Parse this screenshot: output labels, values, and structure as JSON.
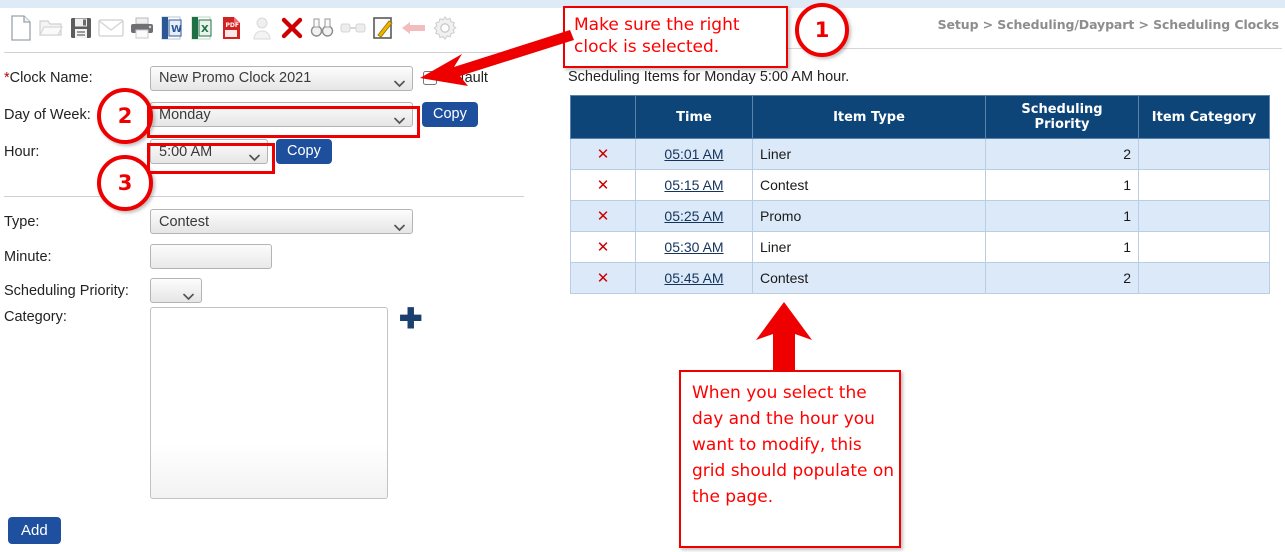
{
  "toolbar": {
    "icons": [
      {
        "name": "new-document-icon",
        "title": "New"
      },
      {
        "name": "open-folder-icon",
        "title": "Open"
      },
      {
        "name": "save-floppy-icon",
        "title": "Save"
      },
      {
        "name": "email-envelope-icon",
        "title": "Email"
      },
      {
        "name": "print-icon",
        "title": "Print"
      },
      {
        "name": "export-word-icon",
        "title": "Export to Word"
      },
      {
        "name": "export-excel-icon",
        "title": "Export to Excel"
      },
      {
        "name": "export-pdf-icon",
        "title": "Export to PDF"
      },
      {
        "name": "user-icon",
        "title": "User"
      },
      {
        "name": "delete-x-icon",
        "title": "Delete"
      },
      {
        "name": "binoculars-icon",
        "title": "Find"
      },
      {
        "name": "link-icon",
        "title": "Link"
      },
      {
        "name": "edit-note-icon",
        "title": "Edit"
      },
      {
        "name": "back-arrow-icon",
        "title": "Back"
      },
      {
        "name": "settings-gear-icon",
        "title": "Settings"
      }
    ]
  },
  "breadcrumb": {
    "text": "Setup > Scheduling/Daypart > Scheduling Clocks"
  },
  "form": {
    "clock_name": {
      "label_star": "*",
      "label": "Clock Name:",
      "value": "New Promo Clock 2021"
    },
    "default_checkbox": {
      "label": "Default",
      "checked": false
    },
    "day_of_week": {
      "label": "Day of Week:",
      "value": "Monday",
      "copy_label": "Copy"
    },
    "hour": {
      "label": "Hour:",
      "value": "5:00 AM",
      "copy_label": "Copy"
    },
    "type": {
      "label": "Type:",
      "value": "Contest"
    },
    "minute": {
      "label": "Minute:",
      "value": "",
      "placeholder": ""
    },
    "scheduling_priority": {
      "label": "Scheduling Priority:",
      "value": ""
    },
    "category": {
      "label": "Category:",
      "value": "",
      "add_icon": "plus-icon"
    },
    "add_button": {
      "label": "Add"
    }
  },
  "grid": {
    "caption": "Scheduling Items for Monday 5:00 AM hour.",
    "columns": [
      "",
      "Time",
      "Item Type",
      "Scheduling Priority",
      "Item Category"
    ],
    "delete_glyph": "✕",
    "rows": [
      {
        "time": "05:01 AM",
        "item_type": "Liner",
        "priority": "2",
        "item_category": ""
      },
      {
        "time": "05:15 AM",
        "item_type": "Contest",
        "priority": "1",
        "item_category": ""
      },
      {
        "time": "05:25 AM",
        "item_type": "Promo",
        "priority": "1",
        "item_category": ""
      },
      {
        "time": "05:30 AM",
        "item_type": "Liner",
        "priority": "1",
        "item_category": ""
      },
      {
        "time": "05:45 AM",
        "item_type": "Contest",
        "priority": "2",
        "item_category": ""
      }
    ]
  },
  "annotations": {
    "callout_top": "Make sure the right clock is selected.",
    "callout_bottom": "When you select the day and the hour you want to modify, this grid should populate on the page.",
    "step_1": "1",
    "step_2": "2",
    "step_3": "3",
    "accent_color": "#ee0000"
  },
  "colors": {
    "header_blue": "#0d4579",
    "button_blue": "#1e4f9c",
    "row_alt": "#dce9f8",
    "annotation_red": "#ee0000",
    "breadcrumb_gray": "#8d8d8d"
  }
}
